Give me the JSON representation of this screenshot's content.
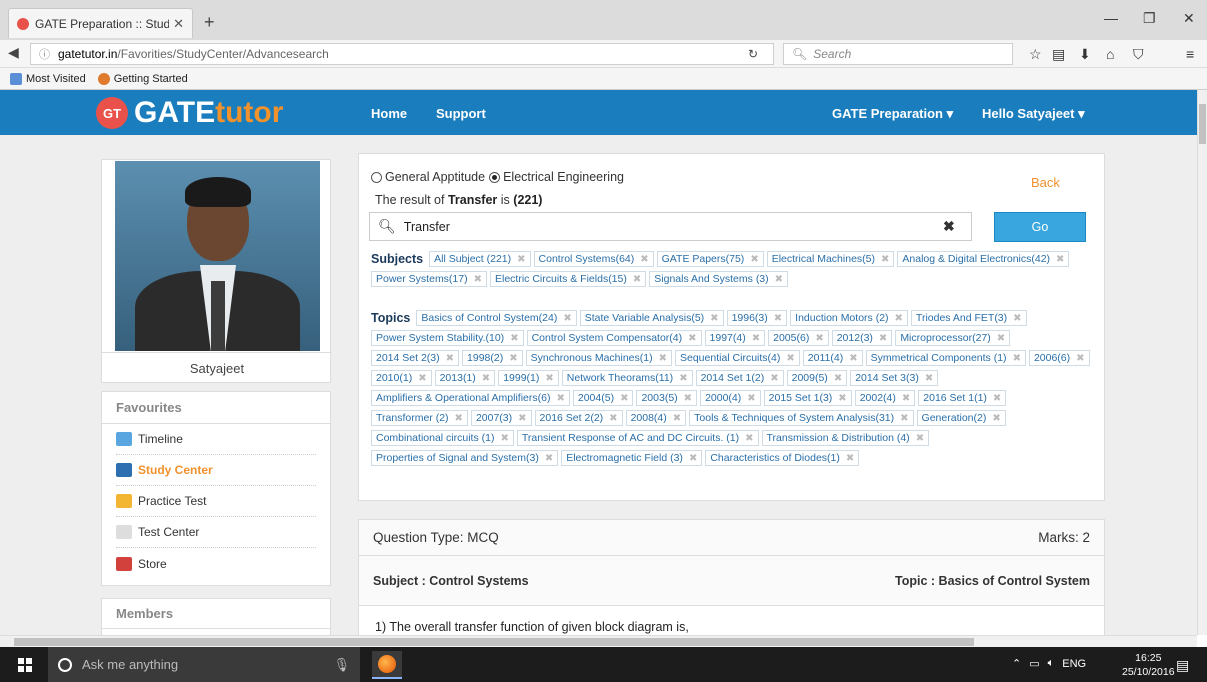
{
  "browser": {
    "tab_title": "GATE Preparation :: Study ...",
    "tab_close": "✕",
    "new_tab": "+",
    "url_domain": "gatetutor.in",
    "url_path": "/Favorities/StudyCenter/Advancesearch",
    "search_placeholder": "Search",
    "bookmarks": [
      "Most Visited",
      "Getting Started"
    ]
  },
  "header": {
    "logo_badge": "GT",
    "logo_gate": "GATE",
    "logo_tutor": "tutor",
    "nav_home": "Home",
    "nav_support": "Support",
    "nav_gate": "GATE Preparation ▾",
    "nav_user": "Hello Satyajeet ▾",
    "brand_color": "#1a7dbd",
    "accent_color": "#f1922d"
  },
  "profile": {
    "name": "Satyajeet"
  },
  "favourites": {
    "title": "Favourites",
    "items": [
      {
        "label": "Timeline",
        "icon": "timeline-icon"
      },
      {
        "label": "Study Center",
        "icon": "study-center-icon",
        "active": true
      },
      {
        "label": "Practice Test",
        "icon": "practice-test-icon"
      },
      {
        "label": "Test Center",
        "icon": "test-center-icon"
      },
      {
        "label": "Store",
        "icon": "store-icon"
      }
    ]
  },
  "members": {
    "title": "Members"
  },
  "search": {
    "radio1": "General Apptitude",
    "radio2": "Electrical Engineering",
    "selected": "Electrical Engineering",
    "back": "Back",
    "result_prefix": "The result of ",
    "result_term": "Transfer",
    "result_mid": " is ",
    "result_count": "(221)",
    "query": "Transfer",
    "go": "Go",
    "subjects_label": "Subjects",
    "topics_label": "Topics",
    "subjects": [
      "All Subject (221)",
      "Control Systems(64)",
      "GATE Papers(75)",
      "Electrical Machines(5)",
      "Analog & Digital Electronics(42)",
      "Power Systems(17)",
      "Electric Circuits & Fields(15)",
      "Signals And Systems (3)"
    ],
    "topics": [
      "Basics of Control System(24)",
      "State Variable Analysis(5)",
      "1996(3)",
      "Induction Motors (2)",
      "Triodes And FET(3)",
      "Power System Stability.(10)",
      "Control System Compensator(4)",
      "1997(4)",
      "2005(6)",
      "2012(3)",
      "Microprocessor(27)",
      "2014 Set 2(3)",
      "1998(2)",
      "Synchronous Machines(1)",
      "Sequential Circuits(4)",
      "2011(4)",
      "Symmetrical Components (1)",
      "2006(6)",
      "2010(1)",
      "2013(1)",
      "1999(1)",
      "Network Theorams(11)",
      "2014 Set 1(2)",
      "2009(5)",
      "2014 Set 3(3)",
      "Amplifiers & Operational Amplifiers(6)",
      "2004(5)",
      "2003(5)",
      "2000(4)",
      "2015 Set 1(3)",
      "2002(4)",
      "2016 Set 1(1)",
      "Transformer (2)",
      "2007(3)",
      "2016 Set 2(2)",
      "2008(4)",
      "Tools & Techniques of System Analysis(31)",
      "Generation(2)",
      "Combinational circuits (1)",
      "Transient Response of AC and DC Circuits. (1)",
      "Transmission & Distribution (4)",
      "Properties of Signal and System(3)",
      "Electromagnetic Field (3)",
      "Characteristics of Diodes(1)"
    ]
  },
  "question": {
    "type": "Question Type: MCQ",
    "marks": "Marks: 2",
    "subject": "Subject : Control Systems",
    "topic": "Topic : Basics of Control System",
    "text": "1) The overall transfer function of given block diagram is,"
  },
  "taskbar": {
    "search_placeholder": "Ask me anything",
    "lang": "ENG",
    "time": "16:25",
    "date": "25/10/2016"
  }
}
